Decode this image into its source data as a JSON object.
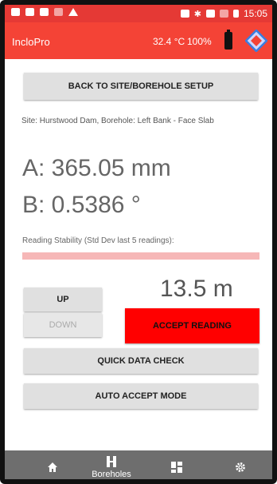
{
  "status_bar": {
    "time": "15:05"
  },
  "app_bar": {
    "title": "IncloPro",
    "temperature": "32.4 °C",
    "battery": "100%"
  },
  "buttons": {
    "back": "BACK TO SITE/BOREHOLE SETUP",
    "up": "UP",
    "down": "DOWN",
    "accept": "ACCEPT READING",
    "quick_check": "QUICK DATA CHECK",
    "auto_accept": "AUTO ACCEPT MODE"
  },
  "site_info": "Site: Hurstwood Dam, Borehole: Left Bank - Face Slab",
  "readings": {
    "a": "A:  365.05 mm",
    "b": "B:  0.5386 °"
  },
  "stability": {
    "label": "Reading Stability (Std Dev last 5 readings):",
    "color": "#f6b7b7"
  },
  "depth": "13.5 m",
  "nav": {
    "boreholes": "Boreholes"
  },
  "colors": {
    "accent": "#f44336",
    "status_bar": "#e53935",
    "accept_button": "#ff0000"
  }
}
